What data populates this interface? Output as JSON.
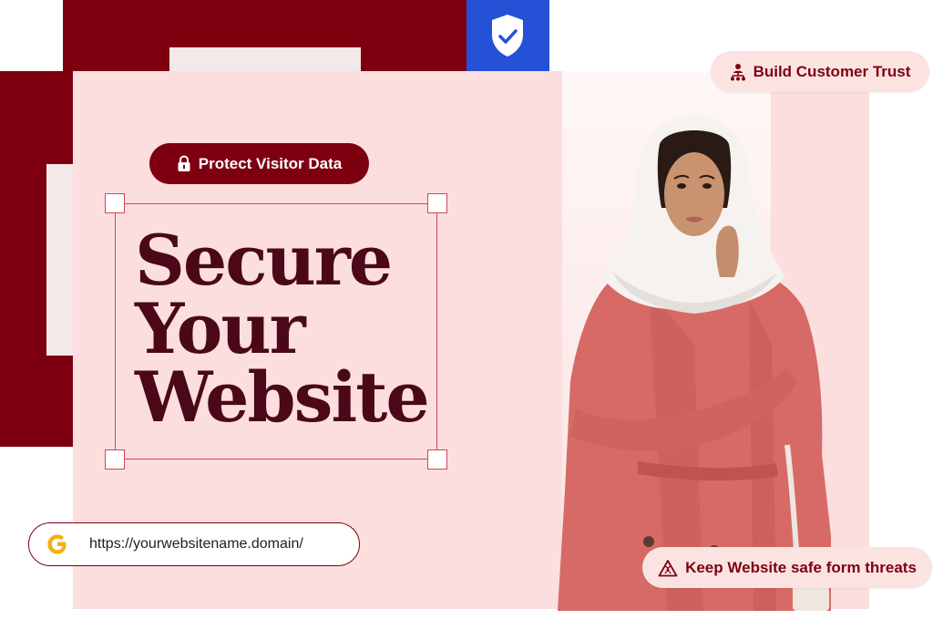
{
  "pills": {
    "protect": "Protect Visitor Data",
    "trust": "Build Customer Trust",
    "threats": "Keep Website safe form threats"
  },
  "headline": {
    "line1": "Secure",
    "line2": "Your",
    "line3": "Website"
  },
  "url_bar": {
    "url": "https://yourwebsitename.domain/"
  },
  "icons": {
    "lock": "lock-icon",
    "shield": "shield-check-icon",
    "trust": "people-network-icon",
    "warning": "warning-triangle-icon",
    "google": "google-g-icon"
  },
  "colors": {
    "maroon": "#7e0010",
    "pink": "#fbdedd",
    "blue": "#2451d6",
    "headline": "#4a0818"
  }
}
